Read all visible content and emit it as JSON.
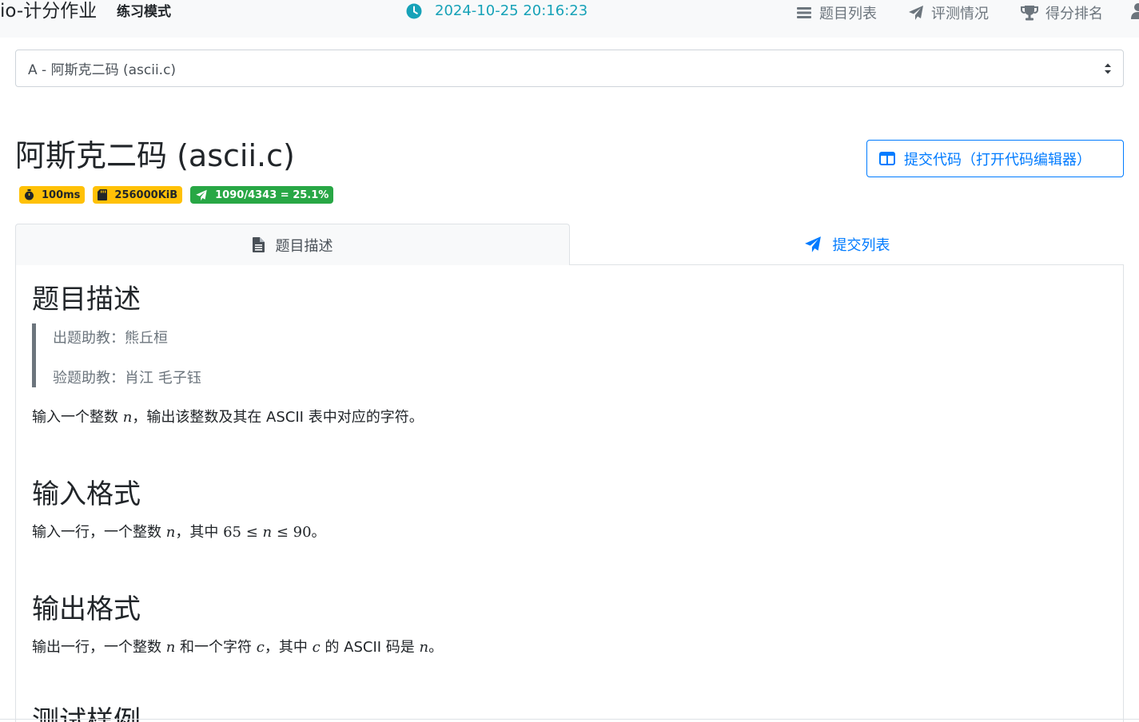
{
  "navbar": {
    "brand": "io-计分作业",
    "mode": "练习模式",
    "clock_time": "2024-10-25 20:16:23",
    "links": [
      {
        "label": "题目列表",
        "icon": "list-icon"
      },
      {
        "label": "评测情况",
        "icon": "paper-plane-icon"
      },
      {
        "label": "得分排名",
        "icon": "trophy-icon"
      }
    ]
  },
  "problem_select": {
    "selected": "A - 阿斯克二码 (ascii.c)"
  },
  "problem": {
    "title": "阿斯克二码 (ascii.c)",
    "time_limit": "100ms",
    "memory_limit": "256000KiB",
    "accept_ratio": "1090/4343 = 25.1%",
    "submit_button": "提交代码（打开代码编辑器）"
  },
  "tabs": {
    "description": "题目描述",
    "submissions": "提交列表"
  },
  "content": {
    "description_heading": "题目描述",
    "setter": "出题助教：熊丘桓",
    "tester": "验题助教：肖江 毛子钰",
    "description_pre": "输入一个整数 ",
    "description_var": "n",
    "description_post": "，输出该整数及其在 ASCII 表中对应的字符。",
    "input_heading": "输入格式",
    "input_pre": "输入一行，一个整数 ",
    "input_var": "n",
    "input_mid": "，其中 ",
    "input_math_low": "65 ≤ ",
    "input_math_var": "n",
    "input_math_high": " ≤ 90",
    "input_post": "。",
    "output_heading": "输出格式",
    "output_pre": "输出一行，一个整数 ",
    "output_var1": "n",
    "output_mid1": " 和一个字符 ",
    "output_var2": "c",
    "output_mid2": "，其中 ",
    "output_var3": "c",
    "output_mid3": " 的 ASCII 码是 ",
    "output_var4": "n",
    "output_post": "。",
    "samples_heading": "测试样例"
  },
  "colors": {
    "primary": "#007bff",
    "info": "#17a2b8",
    "warning": "#ffc107",
    "success": "#28a745",
    "muted": "#6c757d"
  }
}
